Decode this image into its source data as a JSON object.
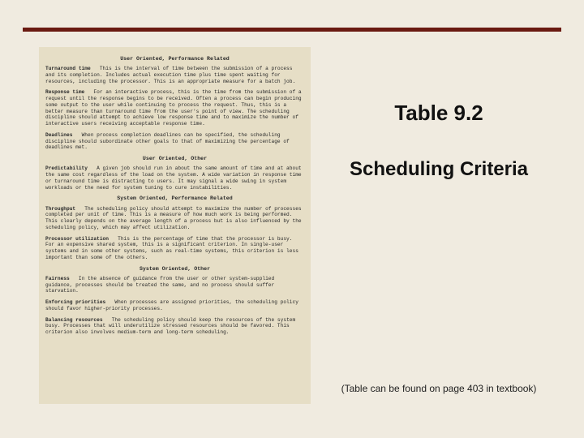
{
  "title_main": "Table 9.2",
  "title_sub": "Scheduling Criteria",
  "footnote": "(Table can be found on page 403 in textbook)",
  "panel": {
    "groups": [
      {
        "heading": "User Oriented, Performance Related",
        "entries": [
          {
            "term": "Turnaround time",
            "desc": "This is the interval of time between the submission of a process and its completion. Includes actual execution time plus time spent waiting for resources, including the processor. This is an appropriate measure for a batch job."
          },
          {
            "term": "Response time",
            "desc": "For an interactive process, this is the time from the submission of a request until the response begins to be received. Often a process can begin producing some output to the user while continuing to process the request. Thus, this is a better measure than turnaround time from the user's point of view. The scheduling discipline should attempt to achieve low response time and to maximize the number of interactive users receiving acceptable response time."
          },
          {
            "term": "Deadlines",
            "desc": "When process completion deadlines can be specified, the scheduling discipline should subordinate other goals to that of maximizing the percentage of deadlines met."
          }
        ]
      },
      {
        "heading": "User Oriented, Other",
        "entries": [
          {
            "term": "Predictability",
            "desc": "A given job should run in about the same amount of time and at about the same cost regardless of the load on the system. A wide variation in response time or turnaround time is distracting to users. It may signal a wide swing in system workloads or the need for system tuning to cure instabilities."
          }
        ]
      },
      {
        "heading": "System Oriented, Performance Related",
        "entries": [
          {
            "term": "Throughput",
            "desc": "The scheduling policy should attempt to maximize the number of processes completed per unit of time. This is a measure of how much work is being performed. This clearly depends on the average length of a process but is also influenced by the scheduling policy, which may affect utilization."
          },
          {
            "term": "Processor utilization",
            "desc": "This is the percentage of time that the processor is busy. For an expensive shared system, this is a significant criterion. In single-user systems and in some other systems, such as real-time systems, this criterion is less important than some of the others."
          }
        ]
      },
      {
        "heading": "System Oriented, Other",
        "entries": [
          {
            "term": "Fairness",
            "desc": "In the absence of guidance from the user or other system-supplied guidance, processes should be treated the same, and no process should suffer starvation."
          },
          {
            "term": "Enforcing priorities",
            "desc": "When processes are assigned priorities, the scheduling policy should favor higher-priority processes."
          },
          {
            "term": "Balancing resources",
            "desc": "The scheduling policy should keep the resources of the system busy. Processes that will underutilize stressed resources should be favored. This criterion also involves medium-term and long-term scheduling."
          }
        ]
      }
    ]
  }
}
